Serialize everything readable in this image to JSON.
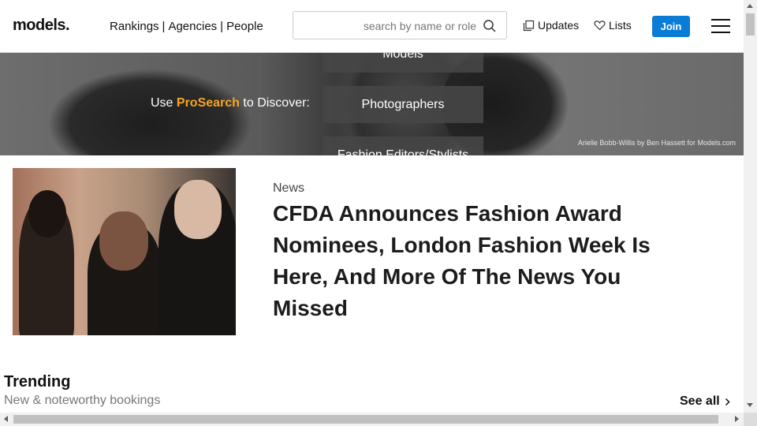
{
  "header": {
    "logo": "models.",
    "nav": [
      "Rankings",
      "Agencies",
      "People"
    ],
    "nav_separator": "|",
    "search_placeholder": "search by name or role",
    "updates_label": "Updates",
    "lists_label": "Lists",
    "join_label": "Join",
    "join_color": "#0a7cd6"
  },
  "banner": {
    "prefix": "Use",
    "brand": "ProSearch",
    "suffix": "to Discover:",
    "brand_color": "#f5a623",
    "options": [
      "Models",
      "Photographers",
      "Fashion Editors/Stylists"
    ],
    "credit": "Arielle Bobb-Willis by Ben Hassett for Models.com"
  },
  "article": {
    "category": "News",
    "headline": "CFDA Announces Fashion Award Nominees, London Fashion Week Is Here, And More Of The News You Missed"
  },
  "trending": {
    "title": "Trending",
    "subtitle": "New & noteworthy bookings",
    "see_all": "See all"
  },
  "icons": {
    "search": "search-icon",
    "updates": "copy-icon",
    "lists": "heart-icon",
    "menu": "hamburger-icon",
    "see_all": "chevron-right-icon"
  }
}
